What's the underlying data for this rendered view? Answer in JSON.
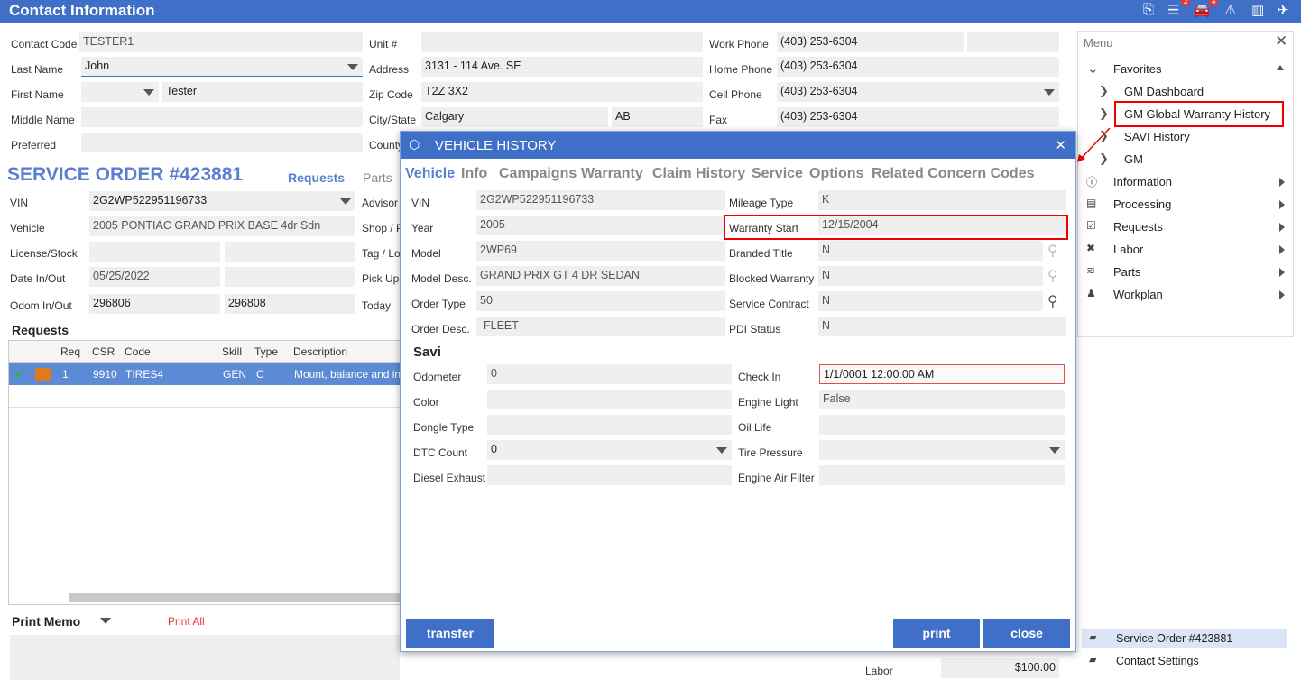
{
  "header": {
    "title": "Contact Information",
    "badges": {
      "list": "2",
      "car": "4"
    }
  },
  "contact": {
    "contact_code_label": "Contact Code",
    "contact_code": "TESTER1",
    "last_name_label": "Last Name",
    "last_name": "John",
    "first_name_label": "First Name",
    "first_name": "Tester",
    "middle_name_label": "Middle Name",
    "preferred_label": "Preferred",
    "unit_label": "Unit #",
    "address_label": "Address",
    "address": "3131 - 114 Ave. SE",
    "zip_label": "Zip Code",
    "zip": "T2Z 3X2",
    "city_label": "City/State",
    "city": "Calgary",
    "state": "AB",
    "county_label": "County",
    "work_phone_label": "Work Phone",
    "work_phone": "(403) 253-6304",
    "home_phone_label": "Home Phone",
    "home_phone": "(403) 253-6304",
    "cell_phone_label": "Cell Phone",
    "cell_phone": "(403) 253-6304",
    "fax_label": "Fax",
    "fax": "(403) 253-6304"
  },
  "service_order": {
    "title": "SERVICE ORDER #423881",
    "requests_tab": "Requests",
    "parts_tab": "Parts",
    "vin_label": "VIN",
    "vin": "2G2WP522951196733",
    "vehicle_label": "Vehicle",
    "vehicle": "2005 PONTIAC GRAND PRIX BASE 4dr Sdn",
    "license_label": "License/Stock",
    "date_label": "Date In/Out",
    "date_in": "05/25/2022",
    "odom_label": "Odom In/Out",
    "odom_in": "296806",
    "odom_out": "296808",
    "advisor_label": "Advisor",
    "shop_label": "Shop / P",
    "tag_label": "Tag / Lo",
    "pickup_label": "Pick Up",
    "today_label": "Today"
  },
  "requests": {
    "title": "Requests",
    "columns": [
      "Req",
      "CSR",
      "Code",
      "Skill",
      "Type",
      "Description"
    ],
    "row": {
      "req": "1",
      "csr": "9910",
      "code": "TIRES4",
      "skill": "GEN",
      "type": "C",
      "description": "Mount, balance and in"
    }
  },
  "print_memo": {
    "label": "Print Memo",
    "print_all": "Print All"
  },
  "footer": {
    "labor_label": "Labor",
    "labor_value": "$100.00"
  },
  "menu": {
    "title": "Menu",
    "favorites": "Favorites",
    "fav_items": [
      "GM Dashboard",
      "GM Global Warranty History",
      "SAVI History",
      "GM"
    ],
    "items": [
      "Information",
      "Processing",
      "Requests",
      "Labor",
      "Parts",
      "Workplan"
    ],
    "service_order_link": "Service Order #423881",
    "contact_settings": "Contact Settings"
  },
  "modal": {
    "title": "VEHICLE HISTORY",
    "tabs": [
      "Vehicle",
      "Info",
      "Campaigns",
      "Warranty",
      "Claim History",
      "Service",
      "Options",
      "Related Concern Codes"
    ],
    "vin_label": "VIN",
    "vin": "2G2WP522951196733",
    "year_label": "Year",
    "year": "2005",
    "model_label": "Model",
    "model": "2WP69",
    "model_desc_label": "Model Desc.",
    "model_desc": "GRAND PRIX GT 4 DR SEDAN",
    "order_type_label": "Order Type",
    "order_type": "50",
    "order_desc_label": "Order Desc.",
    "order_desc": "FLEET",
    "mileage_type_label": "Mileage Type",
    "mileage_type": "K",
    "warranty_start_label": "Warranty Start",
    "warranty_start": "12/15/2004",
    "branded_title_label": "Branded Title",
    "branded_title": "N",
    "blocked_warranty_label": "Blocked Warranty",
    "blocked_warranty": "N",
    "service_contract_label": "Service Contract",
    "service_contract": "N",
    "pdi_status_label": "PDI Status",
    "pdi_status": "N",
    "savi_title": "Savi",
    "odometer_label": "Odometer",
    "odometer": "0",
    "color_label": "Color",
    "dongle_label": "Dongle Type",
    "dtc_label": "DTC Count",
    "dtc": "0",
    "diesel_label": "Diesel Exhaust",
    "checkin_label": "Check In",
    "checkin": "1/1/0001 12:00:00 AM",
    "engine_light_label": "Engine Light",
    "engine_light": "False",
    "oil_life_label": "Oil Life",
    "tire_pressure_label": "Tire Pressure",
    "air_filter_label": "Engine Air Filter",
    "transfer": "transfer",
    "print": "print",
    "close": "close"
  }
}
